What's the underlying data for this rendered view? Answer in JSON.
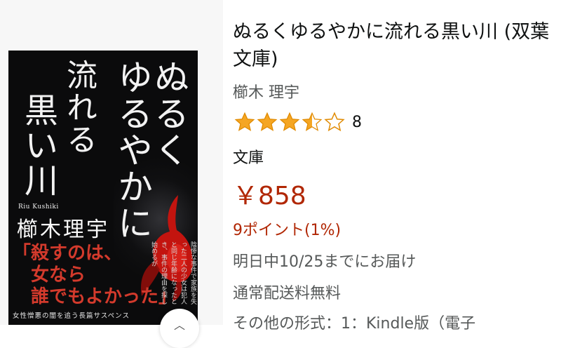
{
  "book": {
    "title": "ぬるくゆるやかに流れる黒い川 (双葉文庫)",
    "author": "櫛木 理宇",
    "rating_value": 3.5,
    "rating_count": "8",
    "format": "文庫",
    "price": "￥858",
    "points": "9ポイント(1%)",
    "delivery": "明日中10/25までにお届け",
    "shipping": "通常配送料無料",
    "other_formats": "その他の形式：1：Kindle版（電子"
  },
  "cover": {
    "title_lines": [
      "ぬるく",
      "ゆるやかに",
      "流れる",
      "黒い川"
    ],
    "author_romaji": "Riu Kushiki",
    "author": "櫛木理宇",
    "quote_lines": [
      "「殺すのは、",
      "女なら",
      "誰でもよかった」"
    ],
    "blurb": "陰惨な事件で家族を失った二人の少女は犯人と同じ年齢になったとき、事件の理由を探し始めるが",
    "tagline": "女性憎悪の闇を追う長篇サスペンス"
  },
  "colors": {
    "price": "#b12704",
    "star": "#f5a623",
    "star_outline": "#e08a00",
    "secondary_text": "#565959"
  },
  "icons": {
    "star_full": "star-icon",
    "star_half": "half-star-icon",
    "star_empty": "empty-star-icon",
    "scroll": "chevron-up-icon"
  }
}
